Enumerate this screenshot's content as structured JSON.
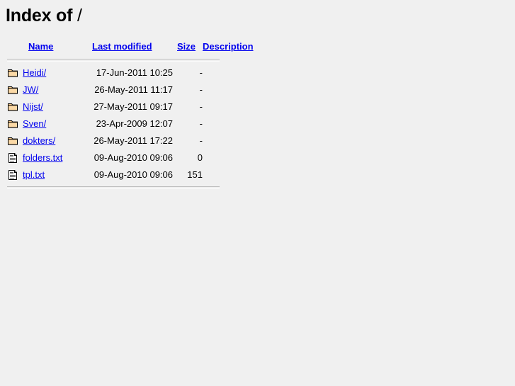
{
  "page": {
    "title_prefix": "Index of",
    "path": "/"
  },
  "table": {
    "headers": [
      {
        "label": "Name",
        "name": "name"
      },
      {
        "label": "Last modified",
        "name": "last-modified"
      },
      {
        "label": "Size",
        "name": "size"
      },
      {
        "label": "Description",
        "name": "description"
      }
    ],
    "rows": [
      {
        "icon": "folder-icon",
        "name": "Heidi/",
        "last_modified": "17-Jun-2011 10:25",
        "size": "-",
        "description": ""
      },
      {
        "icon": "folder-icon",
        "name": "JW/",
        "last_modified": "26-May-2011 11:17",
        "size": "-",
        "description": ""
      },
      {
        "icon": "folder-icon",
        "name": "Nijst/",
        "last_modified": "27-May-2011 09:17",
        "size": "-",
        "description": ""
      },
      {
        "icon": "folder-icon",
        "name": "Sven/",
        "last_modified": "23-Apr-2009 12:07",
        "size": "-",
        "description": ""
      },
      {
        "icon": "folder-icon",
        "name": "dokters/",
        "last_modified": "26-May-2011 17:22",
        "size": "-",
        "description": ""
      },
      {
        "icon": "document-icon",
        "name": "folders.txt",
        "last_modified": "09-Aug-2010 09:06",
        "size": "0",
        "description": ""
      },
      {
        "icon": "document-icon",
        "name": "tpl.txt",
        "last_modified": "09-Aug-2010 09:06",
        "size": "151",
        "description": ""
      }
    ]
  },
  "colors": {
    "background": "#f0f0f0",
    "link": "#0000ee",
    "text": "#000000",
    "rule": "#bdbdbd",
    "folder_fill": "#f7c98a",
    "folder_outline": "#000000",
    "document_fill": "#ffffff",
    "document_outline": "#000000"
  }
}
